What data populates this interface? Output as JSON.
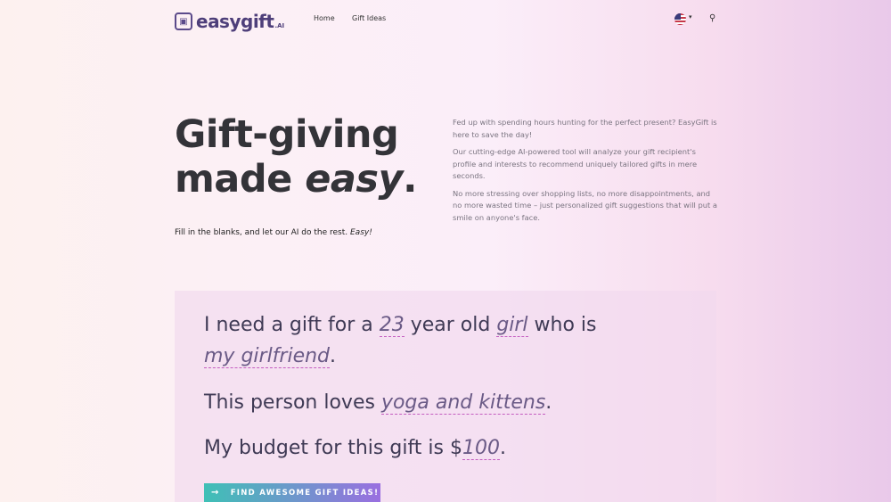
{
  "header": {
    "logo_text": "easygift",
    "logo_suffix": ".AI",
    "nav": [
      "Home",
      "Gift Ideas"
    ],
    "flag_icon": "us-flag-icon",
    "search_icon": "search-icon"
  },
  "hero": {
    "title_line1": "Gift-giving",
    "title_line2_a": "made ",
    "title_line2_b": "easy",
    "title_line2_c": ".",
    "tagline_text": "Fill in the blanks, and let our AI do the rest. ",
    "tagline_em": "Easy!",
    "paragraphs": [
      "Fed up with spending hours hunting for the perfect present? EasyGift is here to save the day!",
      "Our cutting-edge AI-powered tool will analyze your gift recipient's profile and interests to recommend uniquely tailored gifts in mere seconds.",
      "No more stressing over shopping lists, no more disappointments, and no more wasted time – just personalized gift suggestions that will put a smile on anyone's face."
    ]
  },
  "form": {
    "s1_a": "I need a gift for a ",
    "age": "23",
    "s1_b": " year old ",
    "gender": "girl",
    "s1_c": " who is",
    "relation": "my girlfriend",
    "s1_d": ".",
    "s2_a": "This person loves ",
    "interests": "yoga and kittens",
    "s2_b": ".",
    "s3_a": "My budget for this gift is $",
    "budget": "100",
    "s3_b": ".",
    "cta_arrow": "→",
    "cta_label": "FIND AWESOME GIFT IDEAS!"
  }
}
